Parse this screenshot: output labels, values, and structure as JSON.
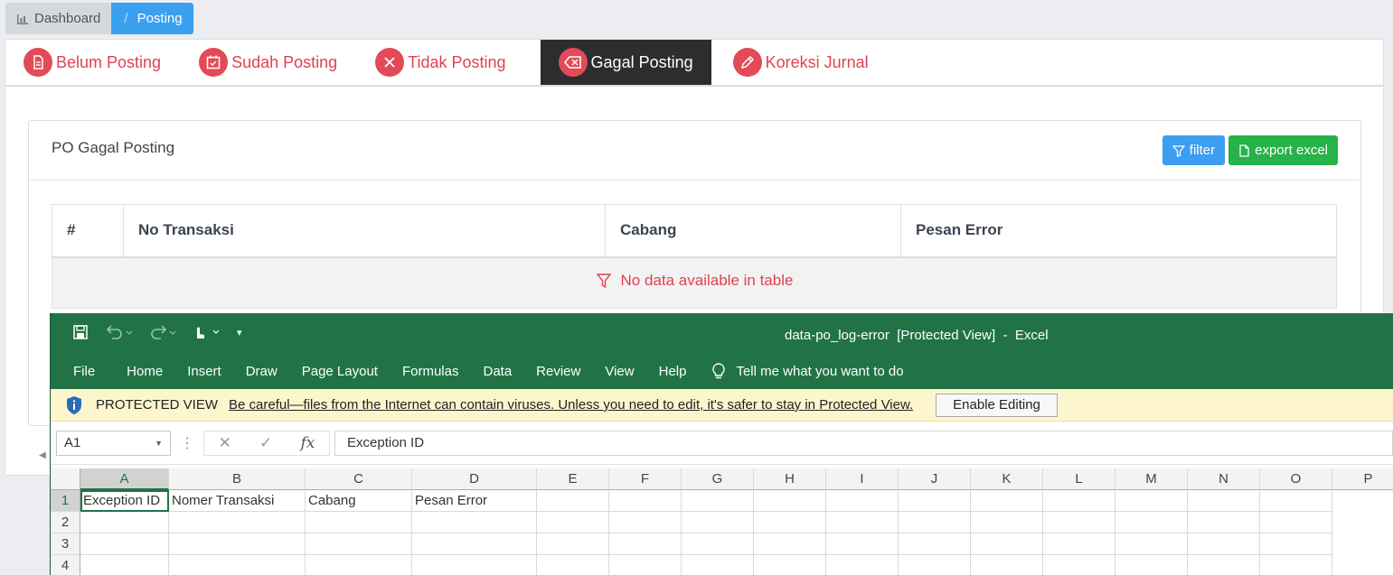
{
  "breadcrumb": {
    "dashboard": "Dashboard",
    "separator": "/",
    "posting": "Posting"
  },
  "tabs": [
    {
      "label": "Belum Posting",
      "icon": "document-icon"
    },
    {
      "label": "Sudah Posting",
      "icon": "calendar-check-icon"
    },
    {
      "label": "Tidak Posting",
      "icon": "close-icon"
    },
    {
      "label": "Gagal Posting",
      "icon": "backspace-icon",
      "active": true
    },
    {
      "label": "Koreksi Jurnal",
      "icon": "pencil-icon"
    }
  ],
  "card": {
    "title": "PO Gagal Posting",
    "filter_label": "filter",
    "export_label": "export excel"
  },
  "table": {
    "headers": [
      "#",
      "No Transaksi",
      "Cabang",
      "Pesan Error"
    ],
    "empty_message": "No data available in table"
  },
  "excel": {
    "window_title": "data-po_log-error  [Protected View]  -  Excel",
    "menu": [
      "File",
      "Home",
      "Insert",
      "Draw",
      "Page Layout",
      "Formulas",
      "Data",
      "Review",
      "View",
      "Help"
    ],
    "tell_me": "Tell me what you want to do",
    "protected_label": "PROTECTED VIEW",
    "protected_message": "Be careful—files from the Internet can contain viruses. Unless you need to edit, it's safer to stay in Protected View.",
    "enable_editing": "Enable Editing",
    "name_box": "A1",
    "formula_value": "Exception ID",
    "columns": [
      "A",
      "B",
      "C",
      "D",
      "E",
      "F",
      "G",
      "H",
      "I",
      "J",
      "K",
      "L",
      "M",
      "N",
      "O",
      "P"
    ],
    "rows": [
      {
        "num": "1",
        "cells": [
          "Exception ID",
          "Nomer Transaksi",
          "Cabang",
          "Pesan Error"
        ]
      },
      {
        "num": "2",
        "cells": []
      },
      {
        "num": "3",
        "cells": []
      },
      {
        "num": "4",
        "cells": []
      }
    ]
  },
  "colors": {
    "tab_red": "#e0414f",
    "excel_green": "#217346",
    "filter_blue": "#3c9ef0",
    "export_green": "#27b24a"
  }
}
